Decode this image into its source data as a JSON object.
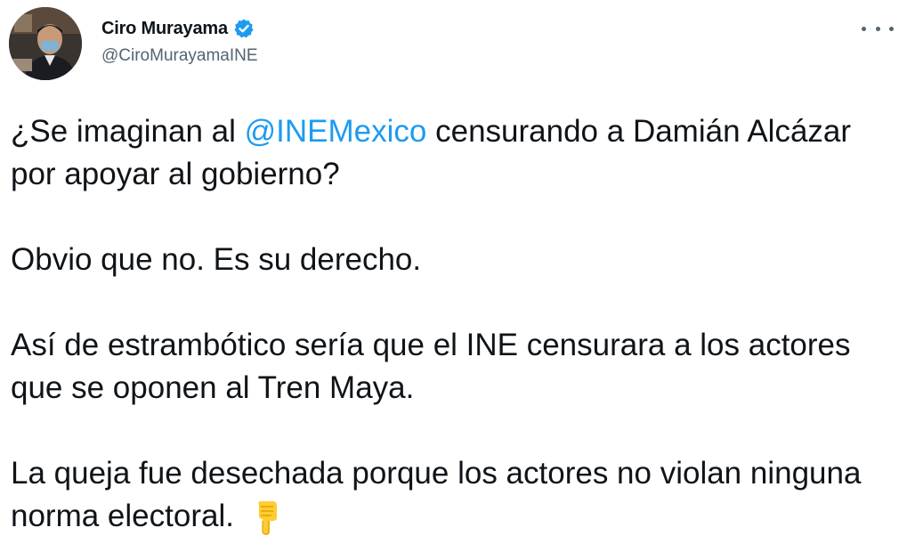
{
  "author": {
    "name": "Ciro Murayama",
    "handle": "@CiroMurayamaINE",
    "verified_icon": "verified-badge-icon",
    "avatar_icon": "profile-photo"
  },
  "menu": {
    "icon": "more-options-icon"
  },
  "tweet": {
    "p1_a": "¿Se imaginan al ",
    "p1_mention": "@INEMexico",
    "p1_b": " censurando a Damián Alcázar por apoyar al gobierno?",
    "p2": "Obvio que no. Es su derecho.",
    "p3": "Así de estrambótico sería que el INE censurara a los actores que se oponen al Tren Maya.",
    "p4": "La queja fue desechada porque los actores no violan ninguna norma electoral.",
    "p4_emoji": "backhand-pointing-down-icon"
  },
  "colors": {
    "text": "#0f1419",
    "secondary": "#536471",
    "link": "#1d9bf0",
    "verified": "#1d9bf0"
  }
}
